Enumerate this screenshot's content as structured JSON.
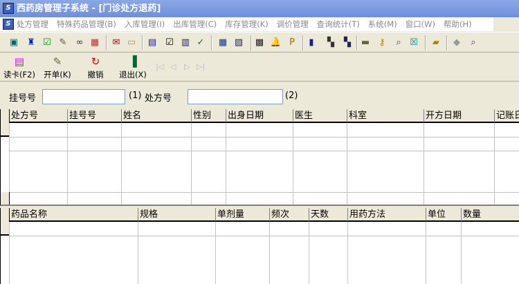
{
  "window": {
    "title": "西药房管理子系统 - [门诊处方退药]"
  },
  "menu": [
    "处方管理",
    "特殊药品管理(B)",
    "入库管理(I)",
    "出库管理(C)",
    "库存管理(K)",
    "调价管理",
    "查询统计(T)",
    "系统(M)",
    "窗口(W)",
    "帮助(H)"
  ],
  "toolbar_icons": [
    "patient-icon",
    "bottle-icon",
    "check-icon",
    "document-icon",
    "binoculars-icon",
    "chart-icon",
    "prescription-icon",
    "card-icon",
    "clipboard-out-icon",
    "checkbox-icon",
    "clipboard-in-icon",
    "document-check-icon",
    "calendar-edit-icon",
    "form-icon",
    "grid-icon",
    "bell-icon",
    "pv-icon",
    "jar-icon",
    "search-binoculars-icon",
    "calendar-binoculars-icon",
    "folder-hand-icon",
    "key-icon",
    "magnifier-icon",
    "close-box-icon",
    "folder-open-icon",
    "disk-icon",
    "zoom-icon"
  ],
  "actions": {
    "read_card": "读卡(F2)",
    "open_order": "开单(K)",
    "undo": "撤销",
    "exit": "退出(X)"
  },
  "search": {
    "reg_label": "挂号号",
    "reg_value": "",
    "reg_hint": "(1)",
    "rx_label": "处方号",
    "rx_value": "",
    "rx_hint": "(2)"
  },
  "grid1": {
    "columns": [
      "处方号",
      "挂号号",
      "姓名",
      "性别",
      "出身日期",
      "医生",
      "科室",
      "开方日期",
      "记账日"
    ]
  },
  "grid2": {
    "columns": [
      "药品名称",
      "规格",
      "单剂量",
      "频次",
      "天数",
      "用药方法",
      "单位",
      "数量"
    ]
  }
}
